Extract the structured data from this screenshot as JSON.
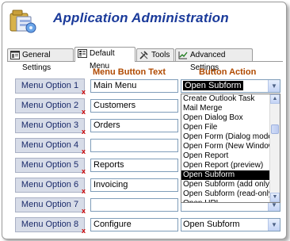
{
  "app": {
    "title": "Application Administration"
  },
  "tabs": [
    {
      "label": "General Settings"
    },
    {
      "label": "Default Menu"
    },
    {
      "label": "Tools"
    },
    {
      "label": "Advanced Settings"
    }
  ],
  "columns": {
    "text": "Menu Button Text",
    "action": "Button Action"
  },
  "remove_mark": "x",
  "rows": [
    {
      "label": "Menu Option 1",
      "text": "Main Menu",
      "action": "Open Subform"
    },
    {
      "label": "Menu Option 2",
      "text": "Customers",
      "action": ""
    },
    {
      "label": "Menu Option 3",
      "text": "Orders",
      "action": ""
    },
    {
      "label": "Menu Option 4",
      "text": "",
      "action": ""
    },
    {
      "label": "Menu Option 5",
      "text": "Reports",
      "action": ""
    },
    {
      "label": "Menu Option 6",
      "text": "Invoicing",
      "action": ""
    },
    {
      "label": "Menu Option 7",
      "text": "",
      "action": ""
    },
    {
      "label": "Menu Option 8",
      "text": "Configure",
      "action": "Open Subform"
    }
  ],
  "dropdown": {
    "items": [
      "Create Outlook Task",
      "Mail Merge",
      "Open Dialog Box",
      "Open File",
      "Open Form (Dialog mode)",
      "Open Form (New Window)",
      "Open Report",
      "Open Report (preview)",
      "Open Subform",
      "Open Subform (add only)",
      "Open Subform (read-only)",
      "Open URL"
    ],
    "selected_index": 8
  }
}
